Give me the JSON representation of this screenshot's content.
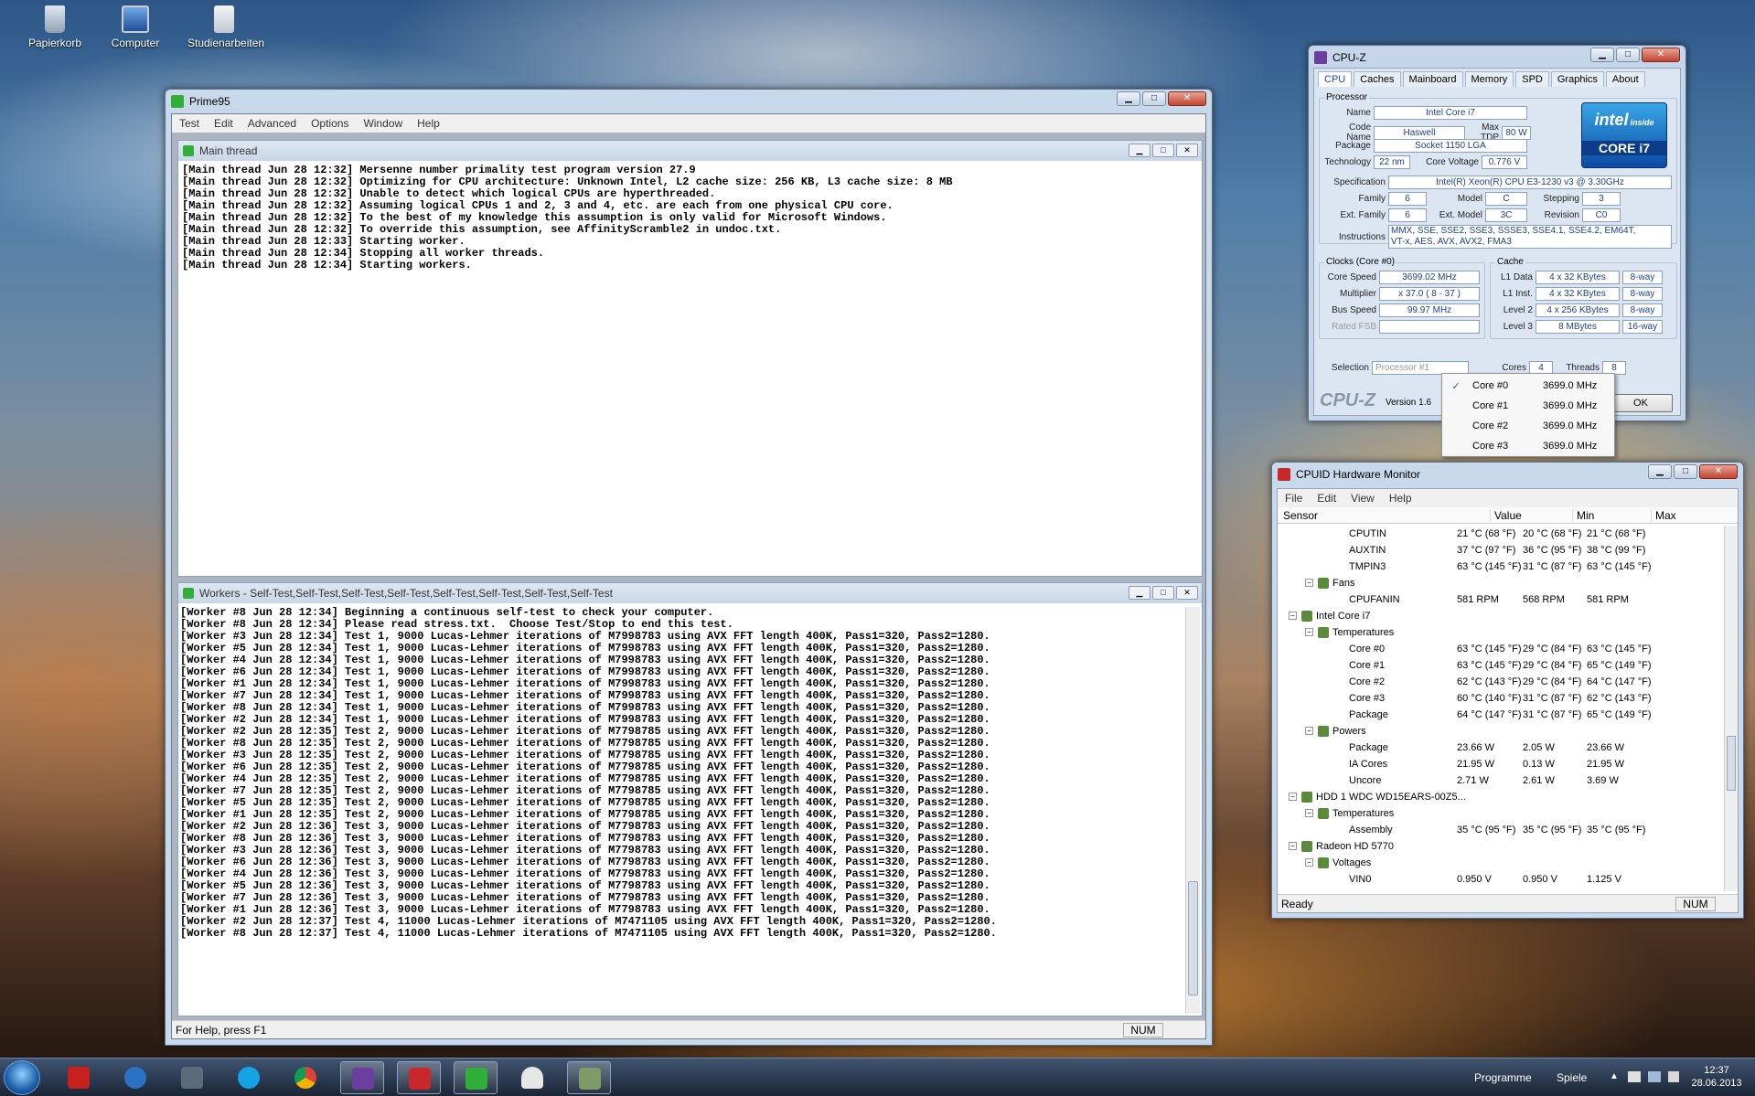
{
  "desktop": {
    "icons": [
      "Papierkorb",
      "Computer",
      "Studienarbeiten"
    ]
  },
  "prime": {
    "title": "Prime95",
    "menu": [
      "Test",
      "Edit",
      "Advanced",
      "Options",
      "Window",
      "Help"
    ],
    "main_title": "Main thread",
    "main_lines": [
      "[Main thread Jun 28 12:32] Mersenne number primality test program version 27.9",
      "[Main thread Jun 28 12:32] Optimizing for CPU architecture: Unknown Intel, L2 cache size: 256 KB, L3 cache size: 8 MB",
      "[Main thread Jun 28 12:32] Unable to detect which logical CPUs are hyperthreaded.",
      "[Main thread Jun 28 12:32] Assuming logical CPUs 1 and 2, 3 and 4, etc. are each from one physical CPU core.",
      "[Main thread Jun 28 12:32] To the best of my knowledge this assumption is only valid for Microsoft Windows.",
      "[Main thread Jun 28 12:32] To override this assumption, see AffinityScramble2 in undoc.txt.",
      "[Main thread Jun 28 12:33] Starting worker.",
      "[Main thread Jun 28 12:34] Stopping all worker threads.",
      "[Main thread Jun 28 12:34] Starting workers."
    ],
    "workers_title": "Workers - Self-Test,Self-Test,Self-Test,Self-Test,Self-Test,Self-Test,Self-Test,Self-Test",
    "worker_lines": [
      "[Worker #8 Jun 28 12:34] Beginning a continuous self-test to check your computer.",
      "[Worker #8 Jun 28 12:34] Please read stress.txt.  Choose Test/Stop to end this test.",
      "[Worker #3 Jun 28 12:34] Test 1, 9000 Lucas-Lehmer iterations of M7998783 using AVX FFT length 400K, Pass1=320, Pass2=1280.",
      "[Worker #5 Jun 28 12:34] Test 1, 9000 Lucas-Lehmer iterations of M7998783 using AVX FFT length 400K, Pass1=320, Pass2=1280.",
      "[Worker #4 Jun 28 12:34] Test 1, 9000 Lucas-Lehmer iterations of M7998783 using AVX FFT length 400K, Pass1=320, Pass2=1280.",
      "[Worker #6 Jun 28 12:34] Test 1, 9000 Lucas-Lehmer iterations of M7998783 using AVX FFT length 400K, Pass1=320, Pass2=1280.",
      "[Worker #1 Jun 28 12:34] Test 1, 9000 Lucas-Lehmer iterations of M7998783 using AVX FFT length 400K, Pass1=320, Pass2=1280.",
      "[Worker #7 Jun 28 12:34] Test 1, 9000 Lucas-Lehmer iterations of M7998783 using AVX FFT length 400K, Pass1=320, Pass2=1280.",
      "[Worker #8 Jun 28 12:34] Test 1, 9000 Lucas-Lehmer iterations of M7998783 using AVX FFT length 400K, Pass1=320, Pass2=1280.",
      "[Worker #2 Jun 28 12:34] Test 1, 9000 Lucas-Lehmer iterations of M7998783 using AVX FFT length 400K, Pass1=320, Pass2=1280.",
      "[Worker #2 Jun 28 12:35] Test 2, 9000 Lucas-Lehmer iterations of M7798785 using AVX FFT length 400K, Pass1=320, Pass2=1280.",
      "[Worker #8 Jun 28 12:35] Test 2, 9000 Lucas-Lehmer iterations of M7798785 using AVX FFT length 400K, Pass1=320, Pass2=1280.",
      "[Worker #3 Jun 28 12:35] Test 2, 9000 Lucas-Lehmer iterations of M7798785 using AVX FFT length 400K, Pass1=320, Pass2=1280.",
      "[Worker #6 Jun 28 12:35] Test 2, 9000 Lucas-Lehmer iterations of M7798785 using AVX FFT length 400K, Pass1=320, Pass2=1280.",
      "[Worker #4 Jun 28 12:35] Test 2, 9000 Lucas-Lehmer iterations of M7798785 using AVX FFT length 400K, Pass1=320, Pass2=1280.",
      "[Worker #7 Jun 28 12:35] Test 2, 9000 Lucas-Lehmer iterations of M7798785 using AVX FFT length 400K, Pass1=320, Pass2=1280.",
      "[Worker #5 Jun 28 12:35] Test 2, 9000 Lucas-Lehmer iterations of M7798785 using AVX FFT length 400K, Pass1=320, Pass2=1280.",
      "[Worker #1 Jun 28 12:35] Test 2, 9000 Lucas-Lehmer iterations of M7798785 using AVX FFT length 400K, Pass1=320, Pass2=1280.",
      "[Worker #2 Jun 28 12:36] Test 3, 9000 Lucas-Lehmer iterations of M7798783 using AVX FFT length 400K, Pass1=320, Pass2=1280.",
      "[Worker #8 Jun 28 12:36] Test 3, 9000 Lucas-Lehmer iterations of M7798783 using AVX FFT length 400K, Pass1=320, Pass2=1280.",
      "[Worker #3 Jun 28 12:36] Test 3, 9000 Lucas-Lehmer iterations of M7798783 using AVX FFT length 400K, Pass1=320, Pass2=1280.",
      "[Worker #6 Jun 28 12:36] Test 3, 9000 Lucas-Lehmer iterations of M7798783 using AVX FFT length 400K, Pass1=320, Pass2=1280.",
      "[Worker #4 Jun 28 12:36] Test 3, 9000 Lucas-Lehmer iterations of M7798783 using AVX FFT length 400K, Pass1=320, Pass2=1280.",
      "[Worker #5 Jun 28 12:36] Test 3, 9000 Lucas-Lehmer iterations of M7798783 using AVX FFT length 400K, Pass1=320, Pass2=1280.",
      "[Worker #7 Jun 28 12:36] Test 3, 9000 Lucas-Lehmer iterations of M7798783 using AVX FFT length 400K, Pass1=320, Pass2=1280.",
      "[Worker #1 Jun 28 12:36] Test 3, 9000 Lucas-Lehmer iterations of M7798783 using AVX FFT length 400K, Pass1=320, Pass2=1280.",
      "[Worker #2 Jun 28 12:37] Test 4, 11000 Lucas-Lehmer iterations of M7471105 using AVX FFT length 400K, Pass1=320, Pass2=1280.",
      "[Worker #8 Jun 28 12:37] Test 4, 11000 Lucas-Lehmer iterations of M7471105 using AVX FFT length 400K, Pass1=320, Pass2=1280."
    ],
    "status": "For Help, press F1",
    "num": "NUM"
  },
  "cpuz": {
    "title": "CPU-Z",
    "tabs": [
      "CPU",
      "Caches",
      "Mainboard",
      "Memory",
      "SPD",
      "Graphics",
      "About"
    ],
    "processor_group": "Processor",
    "name_l": "Name",
    "name": "Intel Core i7",
    "code_l": "Code Name",
    "code": "Haswell",
    "tdp_l": "Max TDP",
    "tdp": "80 W",
    "package_l": "Package",
    "package": "Socket 1150 LGA",
    "tech_l": "Technology",
    "tech": "22 nm",
    "volt_l": "Core Voltage",
    "volt": "0.776 V",
    "spec_l": "Specification",
    "spec": "Intel(R) Xeon(R) CPU E3-1230 v3 @ 3.30GHz",
    "family_l": "Family",
    "family": "6",
    "model_l": "Model",
    "model": "C",
    "stepping_l": "Stepping",
    "stepping": "3",
    "extfam_l": "Ext. Family",
    "extfam": "6",
    "extmodel_l": "Ext. Model",
    "extmodel": "3C",
    "rev_l": "Revision",
    "rev": "C0",
    "instr_l": "Instructions",
    "instr1": "MMX, SSE, SSE2, SSE3, SSSE3, SSE4.1, SSE4.2, EM64T,",
    "instr2": "VT-x, AES, AVX, AVX2, FMA3",
    "badge_top": "intel",
    "badge_inside": "inside",
    "badge_core": "CORE i7",
    "clocks_group": "Clocks (Core #0)",
    "speed_l": "Core Speed",
    "speed": "3699.02 MHz",
    "mult_l": "Multiplier",
    "mult": "x 37.0 ( 8 - 37 )",
    "bus_l": "Bus Speed",
    "bus": "99.97 MHz",
    "fsb_l": "Rated FSB",
    "fsb": "",
    "cache_group": "Cache",
    "l1d_l": "L1 Data",
    "l1d": "4 x 32 KBytes",
    "l1d_w": "8-way",
    "l1i_l": "L1 Inst.",
    "l1i": "4 x 32 KBytes",
    "l1i_w": "8-way",
    "l2_l": "Level 2",
    "l2": "4 x 256 KBytes",
    "l2_w": "8-way",
    "l3_l": "Level 3",
    "l3": "8 MBytes",
    "l3_w": "16-way",
    "sel_l": "Selection",
    "sel": "Processor #1",
    "cores_l": "Cores",
    "cores": "4",
    "threads_l": "Threads",
    "threads": "8",
    "logo": "CPU-Z",
    "version": "Version 1.6",
    "ok": "OK",
    "dropdown": [
      {
        "name": "Core #0",
        "mhz": "3699.0 MHz",
        "check": "✓"
      },
      {
        "name": "Core #1",
        "mhz": "3699.0 MHz",
        "check": ""
      },
      {
        "name": "Core #2",
        "mhz": "3699.0 MHz",
        "check": ""
      },
      {
        "name": "Core #3",
        "mhz": "3699.0 MHz",
        "check": ""
      }
    ]
  },
  "hwmon": {
    "title": "CPUID Hardware Monitor",
    "menu": [
      "File",
      "Edit",
      "View",
      "Help"
    ],
    "headers": [
      "Sensor",
      "Value",
      "Min",
      "Max"
    ],
    "rows": [
      {
        "indent": 3,
        "name": "CPUTIN",
        "v": "21 °C  (68 °F)",
        "min": "20 °C  (68 °F)",
        "max": "21 °C  (68 °F)"
      },
      {
        "indent": 3,
        "name": "AUXTIN",
        "v": "37 °C  (97 °F)",
        "min": "36 °C  (95 °F)",
        "max": "38 °C  (99 °F)"
      },
      {
        "indent": 3,
        "name": "TMPIN3",
        "v": "63 °C  (145 °F)",
        "min": "31 °C  (87 °F)",
        "max": "63 °C  (145 °F)"
      },
      {
        "indent": 2,
        "name": "Fans",
        "v": "",
        "min": "",
        "max": "",
        "node": true
      },
      {
        "indent": 3,
        "name": "CPUFANIN",
        "v": "581 RPM",
        "min": "568 RPM",
        "max": "581 RPM"
      },
      {
        "indent": 1,
        "name": "Intel Core i7",
        "v": "",
        "min": "",
        "max": "",
        "node": true
      },
      {
        "indent": 2,
        "name": "Temperatures",
        "v": "",
        "min": "",
        "max": "",
        "node": true
      },
      {
        "indent": 3,
        "name": "Core #0",
        "v": "63 °C  (145 °F)",
        "min": "29 °C  (84 °F)",
        "max": "63 °C  (145 °F)"
      },
      {
        "indent": 3,
        "name": "Core #1",
        "v": "63 °C  (145 °F)",
        "min": "29 °C  (84 °F)",
        "max": "65 °C  (149 °F)"
      },
      {
        "indent": 3,
        "name": "Core #2",
        "v": "62 °C  (143 °F)",
        "min": "29 °C  (84 °F)",
        "max": "64 °C  (147 °F)"
      },
      {
        "indent": 3,
        "name": "Core #3",
        "v": "60 °C  (140 °F)",
        "min": "31 °C  (87 °F)",
        "max": "62 °C  (143 °F)"
      },
      {
        "indent": 3,
        "name": "Package",
        "v": "64 °C  (147 °F)",
        "min": "31 °C  (87 °F)",
        "max": "65 °C  (149 °F)"
      },
      {
        "indent": 2,
        "name": "Powers",
        "v": "",
        "min": "",
        "max": "",
        "node": true
      },
      {
        "indent": 3,
        "name": "Package",
        "v": "23.66 W",
        "min": "2.05 W",
        "max": "23.66 W"
      },
      {
        "indent": 3,
        "name": "IA Cores",
        "v": "21.95 W",
        "min": "0.13 W",
        "max": "21.95 W"
      },
      {
        "indent": 3,
        "name": "Uncore",
        "v": "2.71 W",
        "min": "2.61 W",
        "max": "3.69 W"
      },
      {
        "indent": 1,
        "name": "HDD 1 WDC WD15EARS-00Z5...",
        "v": "",
        "min": "",
        "max": "",
        "node": true
      },
      {
        "indent": 2,
        "name": "Temperatures",
        "v": "",
        "min": "",
        "max": "",
        "node": true
      },
      {
        "indent": 3,
        "name": "Assembly",
        "v": "35 °C  (95 °F)",
        "min": "35 °C  (95 °F)",
        "max": "35 °C  (95 °F)"
      },
      {
        "indent": 1,
        "name": "Radeon HD 5770",
        "v": "",
        "min": "",
        "max": "",
        "node": true
      },
      {
        "indent": 2,
        "name": "Voltages",
        "v": "",
        "min": "",
        "max": "",
        "node": true
      },
      {
        "indent": 3,
        "name": "VIN0",
        "v": "0.950 V",
        "min": "0.950 V",
        "max": "1.125 V"
      }
    ],
    "status": "Ready",
    "num": "NUM"
  },
  "taskbar": {
    "programme": "Programme",
    "spiele": "Spiele",
    "time": "12:37",
    "date": "28.06.2013"
  }
}
